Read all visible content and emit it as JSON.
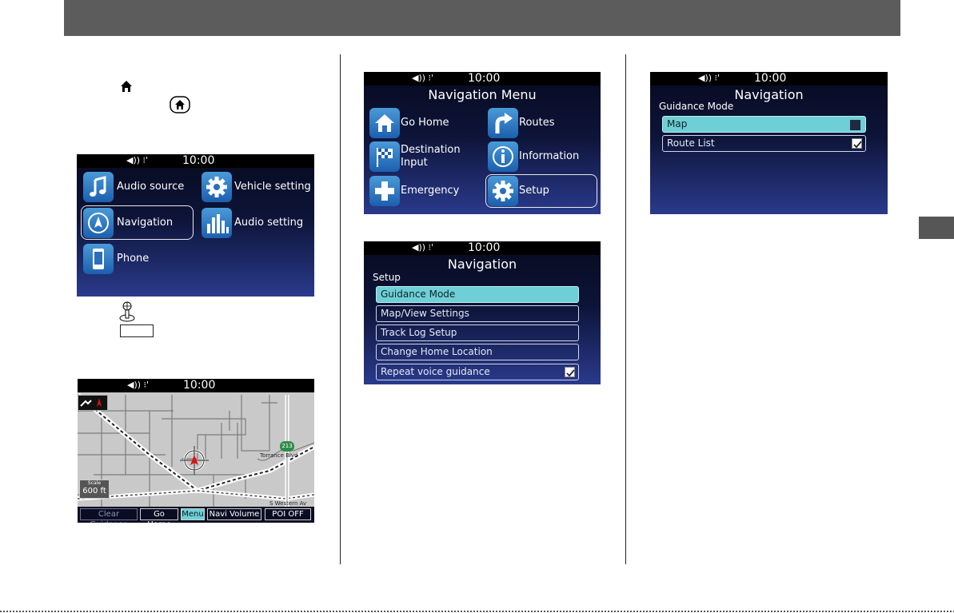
{
  "status": {
    "time": "10:00",
    "volume_glyph": "◀)) ⁝'"
  },
  "icons": {
    "home": "home-icon",
    "home_button": "home-button-icon",
    "joystick": "joystick-icon"
  },
  "home_screen": {
    "items": [
      {
        "label": "Audio source",
        "icon": "music-note-icon"
      },
      {
        "label": "Vehicle setting",
        "icon": "gear-icon"
      },
      {
        "label": "Navigation",
        "icon": "compass-icon",
        "selected": true
      },
      {
        "label": "Audio setting",
        "icon": "equalizer-icon"
      },
      {
        "label": "Phone",
        "icon": "phone-icon"
      }
    ]
  },
  "map_screen": {
    "scale_label": "Scale",
    "scale_value": "600 ft",
    "road_label_1": "Torrance Blvd",
    "road_label_2": "S Western Av",
    "shield": "213",
    "buttons": [
      "Clear Guidance",
      "Go Home",
      "Menu",
      "Navi Volume",
      "POI OFF"
    ]
  },
  "nav_menu": {
    "title": "Navigation Menu",
    "items": [
      {
        "label": "Go Home",
        "icon": "home-icon"
      },
      {
        "label": "Routes",
        "icon": "route-arrow-icon"
      },
      {
        "label": "Destination\nInput",
        "icon": "checkered-flag-icon"
      },
      {
        "label": "Information",
        "icon": "info-icon"
      },
      {
        "label": "Emergency",
        "icon": "plus-icon"
      },
      {
        "label": "Setup",
        "icon": "gear-icon",
        "selected": true
      }
    ]
  },
  "setup_screen": {
    "title": "Navigation",
    "subtitle": "Setup",
    "items": [
      {
        "label": "Guidance Mode",
        "selected": true
      },
      {
        "label": "Map/View Settings"
      },
      {
        "label": "Track Log Setup"
      },
      {
        "label": "Change Home Location"
      },
      {
        "label": "Repeat voice guidance",
        "checked": true
      }
    ]
  },
  "guidance_screen": {
    "title": "Navigation",
    "subtitle": "Guidance Mode",
    "items": [
      {
        "label": "Map",
        "selected": true,
        "checked": false
      },
      {
        "label": "Route List",
        "checked": true
      }
    ]
  }
}
